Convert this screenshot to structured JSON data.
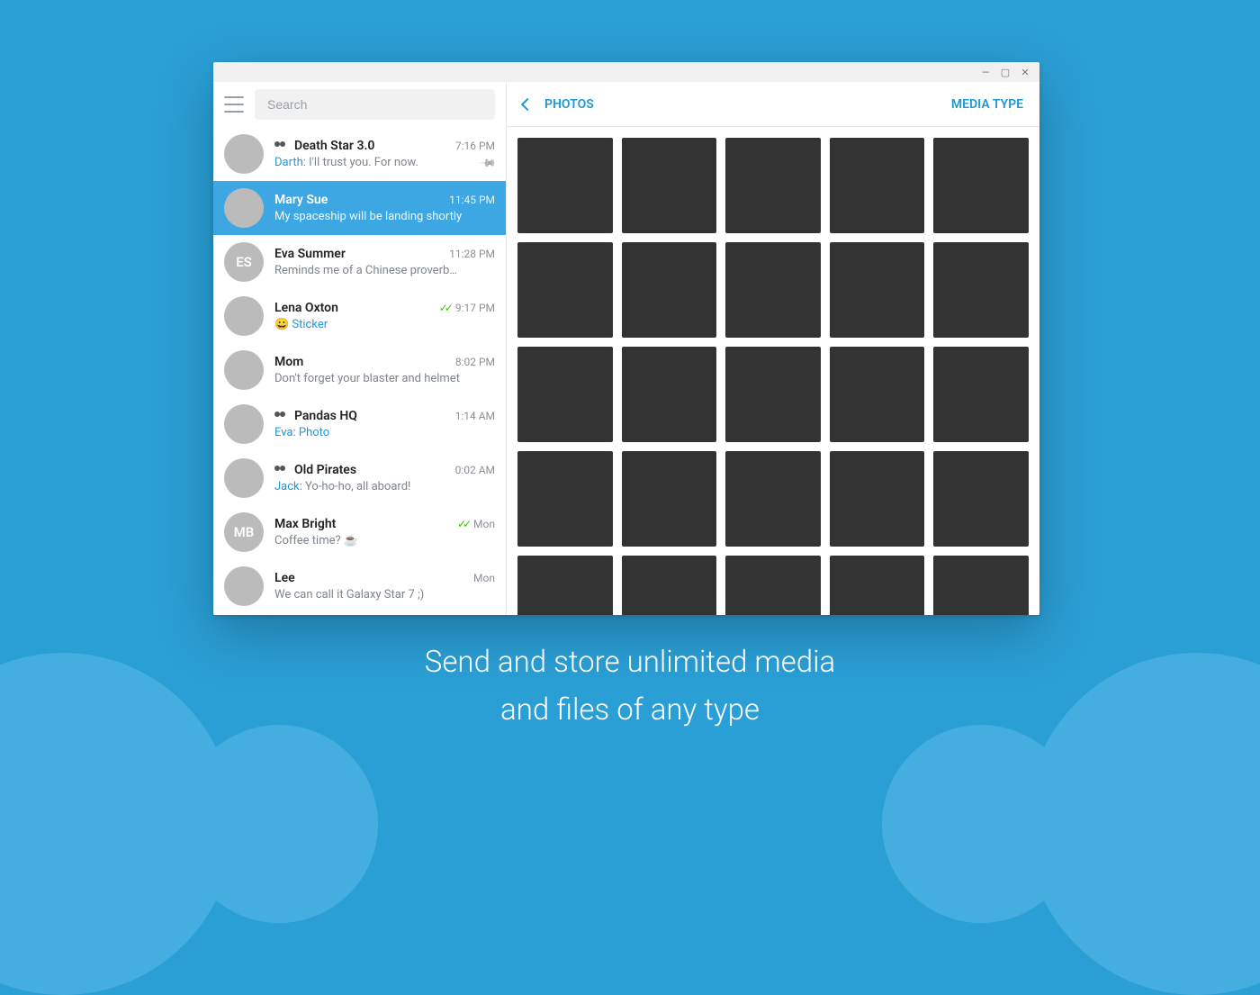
{
  "search": {
    "placeholder": "Search"
  },
  "media_panel": {
    "title": "PHOTOS",
    "type_button": "MEDIA TYPE"
  },
  "caption": {
    "line1": "Send and store unlimited media",
    "line2": "and files of any type"
  },
  "chats": [
    {
      "id": "death-star",
      "name": "Death Star 3.0",
      "group": true,
      "avatar_class": "av-a",
      "avatar_initials": "",
      "time": "7:16 PM",
      "sender": "Darth:",
      "preview_text": " I'll trust you. For now.",
      "pinned": true,
      "checks": false,
      "emoji": "",
      "selected": false,
      "link": false
    },
    {
      "id": "mary-sue",
      "name": "Mary Sue",
      "group": false,
      "avatar_class": "av-b",
      "avatar_initials": "",
      "time": "11:45 PM",
      "sender": "",
      "preview_text": "My spaceship will be landing shortly",
      "pinned": false,
      "checks": false,
      "emoji": "",
      "selected": true,
      "link": false
    },
    {
      "id": "eva-summer",
      "name": "Eva Summer",
      "group": false,
      "avatar_class": "av-c",
      "avatar_initials": "ES",
      "time": "11:28 PM",
      "sender": "",
      "preview_text": "Reminds me of a Chinese proverb…",
      "pinned": false,
      "checks": false,
      "emoji": "",
      "selected": false,
      "link": false
    },
    {
      "id": "lena-oxton",
      "name": "Lena Oxton",
      "group": false,
      "avatar_class": "av-d",
      "avatar_initials": "",
      "time": "9:17 PM",
      "sender": "",
      "preview_text": "Sticker",
      "pinned": false,
      "checks": true,
      "emoji": "😀",
      "selected": false,
      "link": true
    },
    {
      "id": "mom",
      "name": "Mom",
      "group": false,
      "avatar_class": "av-e",
      "avatar_initials": "",
      "time": "8:02 PM",
      "sender": "",
      "preview_text": "Don't forget your blaster and helmet",
      "pinned": false,
      "checks": false,
      "emoji": "",
      "selected": false,
      "link": false
    },
    {
      "id": "pandas-hq",
      "name": "Pandas HQ",
      "group": true,
      "avatar_class": "av-f",
      "avatar_initials": "",
      "time": "1:14 AM",
      "sender": "Eva:",
      "preview_text": " Photo",
      "pinned": false,
      "checks": false,
      "emoji": "",
      "selected": false,
      "link": true
    },
    {
      "id": "old-pirates",
      "name": "Old Pirates",
      "group": true,
      "avatar_class": "av-g",
      "avatar_initials": "",
      "time": "0:02 AM",
      "sender": "Jack:",
      "preview_text": " Yo-ho-ho, all aboard!",
      "pinned": false,
      "checks": false,
      "emoji": "",
      "selected": false,
      "link": false
    },
    {
      "id": "max-bright",
      "name": "Max Bright",
      "group": false,
      "avatar_class": "av-h",
      "avatar_initials": "MB",
      "time": "Mon",
      "sender": "",
      "preview_text": "Coffee time? ☕",
      "pinned": false,
      "checks": true,
      "emoji": "",
      "selected": false,
      "link": false
    },
    {
      "id": "lee",
      "name": "Lee",
      "group": false,
      "avatar_class": "av-i",
      "avatar_initials": "",
      "time": "Mon",
      "sender": "",
      "preview_text": "We can call it Galaxy Star 7 ;)",
      "pinned": false,
      "checks": false,
      "emoji": "",
      "selected": false,
      "link": false
    }
  ],
  "media_count": 25
}
